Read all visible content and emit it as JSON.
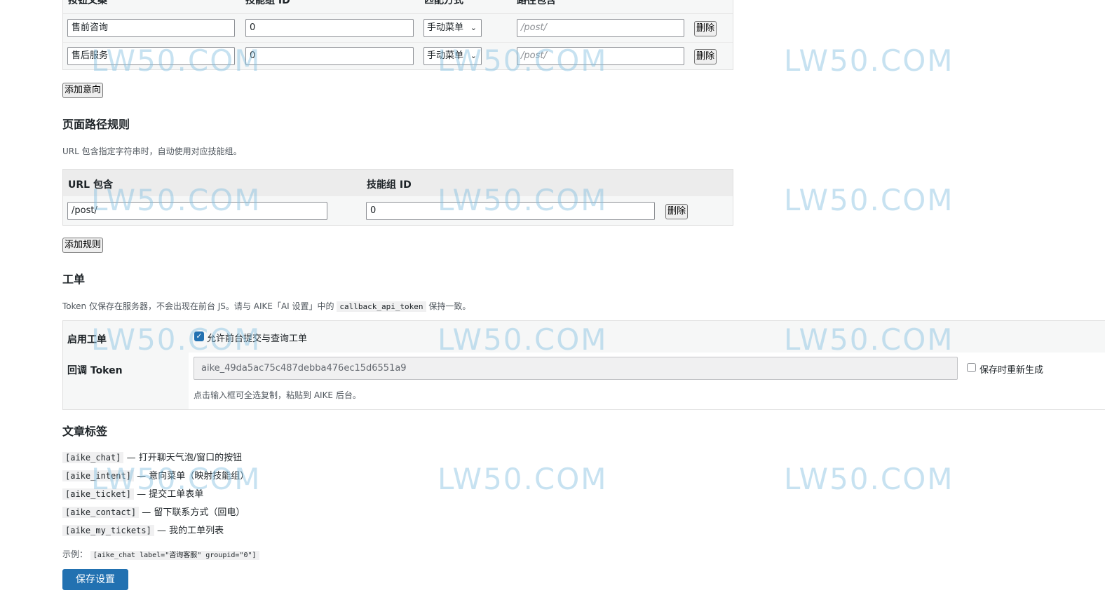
{
  "intents": {
    "headers": {
      "label": "按钮文案",
      "group_id": "技能组 ID",
      "match": "匹配方式",
      "path": "路径包含"
    },
    "rows": [
      {
        "label": "售前咨询",
        "group_id": "0",
        "match": "手动菜单",
        "path_placeholder": "/post/",
        "delete": "删除"
      },
      {
        "label": "售后服务",
        "group_id": "0",
        "match": "手动菜单",
        "path_placeholder": "/post/",
        "delete": "删除"
      }
    ],
    "add_button": "添加意向"
  },
  "page_rules": {
    "title": "页面路径规则",
    "description": "URL 包含指定字符串时，自动使用对应技能组。",
    "headers": {
      "url": "URL 包含",
      "group_id": "技能组 ID"
    },
    "rows": [
      {
        "url": "/post/",
        "group_id": "0",
        "delete": "删除"
      }
    ],
    "add_button": "添加规则"
  },
  "tickets": {
    "title": "工单",
    "description_pre": "Token 仅保存在服务器，不会出现在前台 JS。请与 AIKE「AI 设置」中的",
    "description_code": "callback_api_token",
    "description_post": "保持一致。",
    "enable_label": "启用工单",
    "enable_checkbox_label": "允许前台提交与查询工单",
    "enable_checked": true,
    "token_label": "回调 Token",
    "token_value": "aike_49da5ac75c487debba476ec15d6551a9",
    "regenerate_label": "保存时重新生成",
    "regenerate_checked": false,
    "token_hint": "点击输入框可全选复制，粘贴到 AIKE 后台。"
  },
  "shortcodes": {
    "title": "文章标签",
    "items": [
      {
        "code": "[aike_chat]",
        "desc": "— 打开聊天气泡/窗口的按钮"
      },
      {
        "code": "[aike_intent]",
        "desc": "— 意向菜单（映射技能组）"
      },
      {
        "code": "[aike_ticket]",
        "desc": "— 提交工单表单"
      },
      {
        "code": "[aike_contact]",
        "desc": "— 留下联系方式（回电）"
      },
      {
        "code": "[aike_my_tickets]",
        "desc": "— 我的工单列表"
      }
    ],
    "example_label": "示例：",
    "example_code": "[aike_chat label=\"咨询客服\" groupid=\"0\"]"
  },
  "save_button": "保存设置",
  "watermark": "LW50.COM",
  "colors": {
    "primary": "#2271b1",
    "panel": "#f6f7f7",
    "watermark": "#82bee1"
  }
}
